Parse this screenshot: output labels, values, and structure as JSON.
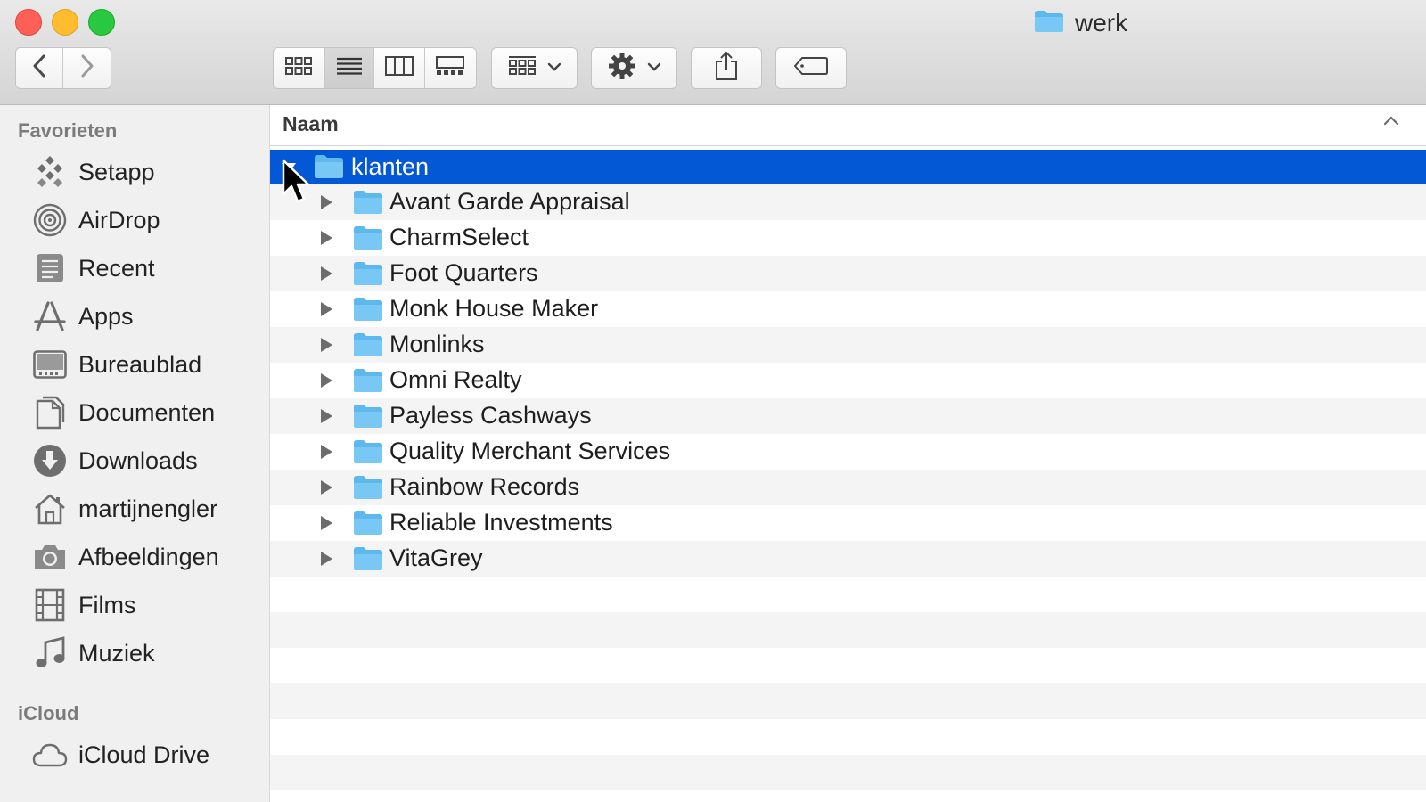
{
  "window": {
    "title": "werk"
  },
  "toolbar": {
    "back_icon": "chevron-left-icon",
    "forward_icon": "chevron-right-icon",
    "view_modes": [
      "icon-view-icon",
      "list-view-icon",
      "column-view-icon",
      "gallery-view-icon"
    ],
    "active_view": "list-view-icon",
    "group_icon": "group-icon",
    "action_icon": "gear-icon",
    "share_icon": "share-icon",
    "tag_icon": "tag-icon"
  },
  "sidebar": {
    "favorites_title": "Favorieten",
    "favorites": [
      {
        "label": "Setapp",
        "icon": "setapp-icon"
      },
      {
        "label": "AirDrop",
        "icon": "airdrop-icon"
      },
      {
        "label": "Recent",
        "icon": "recent-icon"
      },
      {
        "label": "Apps",
        "icon": "apps-icon"
      },
      {
        "label": "Bureaublad",
        "icon": "desktop-icon"
      },
      {
        "label": "Documenten",
        "icon": "document-icon"
      },
      {
        "label": "Downloads",
        "icon": "download-icon"
      },
      {
        "label": "martijnengler",
        "icon": "home-icon"
      },
      {
        "label": "Afbeeldingen",
        "icon": "camera-icon"
      },
      {
        "label": "Films",
        "icon": "film-icon"
      },
      {
        "label": "Muziek",
        "icon": "music-icon"
      }
    ],
    "icloud_title": "iCloud",
    "icloud": [
      {
        "label": "iCloud Drive",
        "icon": "cloud-icon"
      }
    ]
  },
  "list": {
    "column_name": "Naam",
    "parent": {
      "label": "klanten",
      "expanded": true,
      "selected": true
    },
    "children": [
      "Avant Garde Appraisal",
      "CharmSelect",
      "Foot Quarters",
      "Monk House Maker",
      "Monlinks",
      "Omni Realty",
      "Payless Cashways",
      "Quality Merchant Services",
      "Rainbow Records",
      "Reliable Investments",
      "VitaGrey"
    ]
  },
  "colors": {
    "selection": "#0358d6",
    "folder": "#4fb0ec",
    "close": "#fe5f57",
    "minimize": "#febc2e",
    "zoom": "#28c840"
  }
}
